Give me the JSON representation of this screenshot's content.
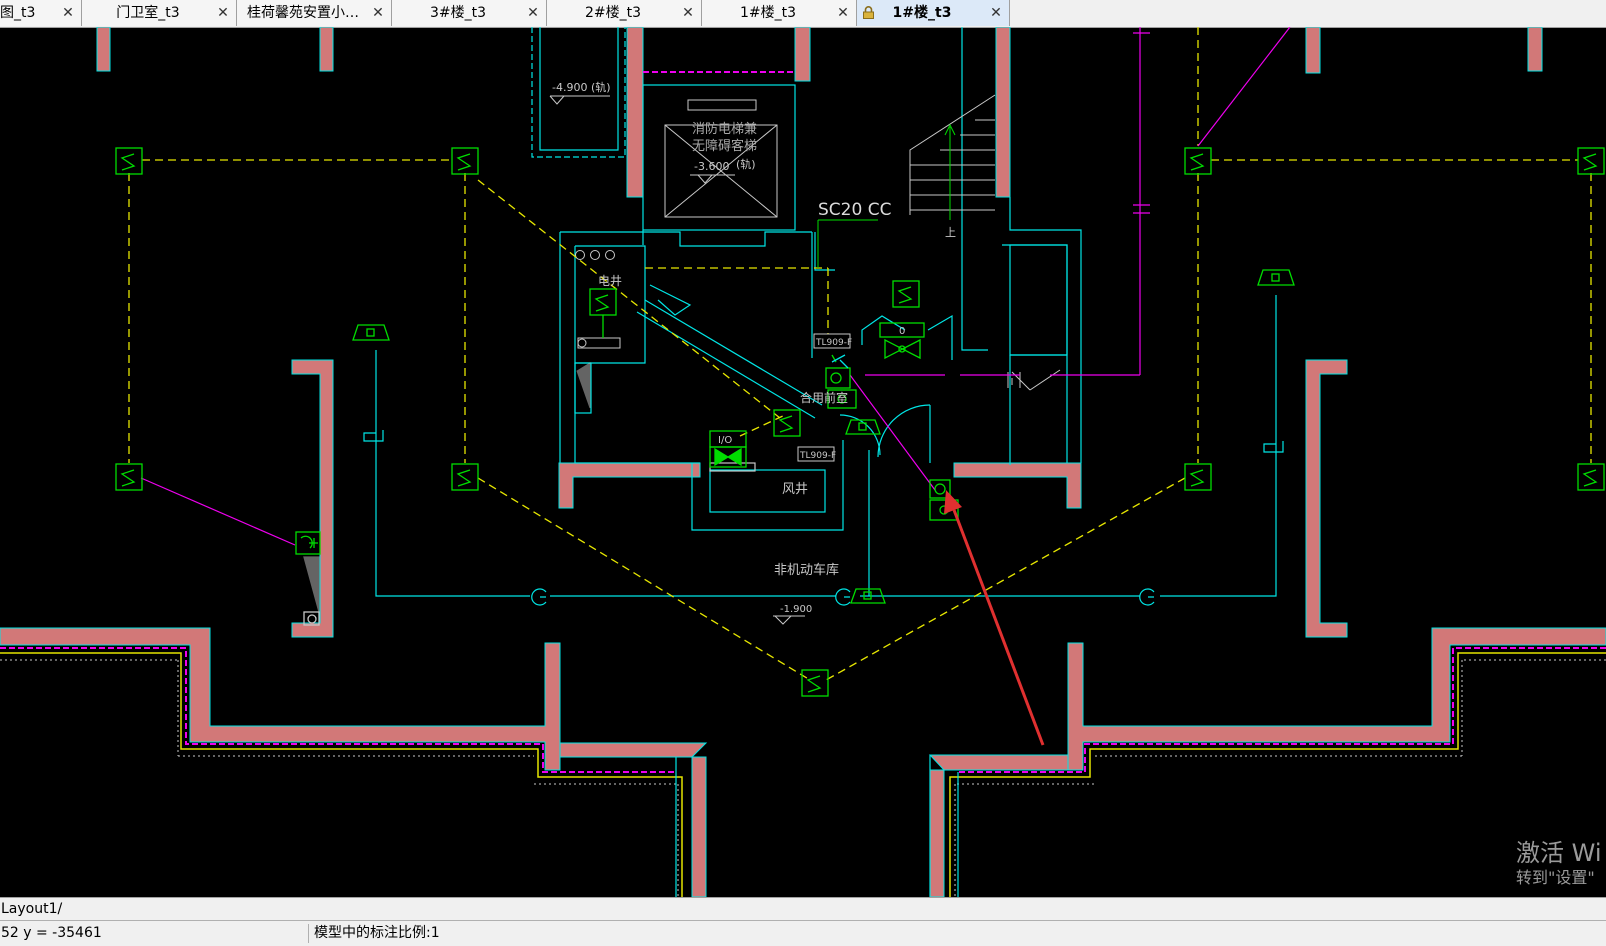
{
  "tabs": [
    {
      "label": "图_t3",
      "close": "✕",
      "active": false,
      "locked": false
    },
    {
      "label": "门卫室_t3",
      "close": "✕",
      "active": false,
      "locked": false
    },
    {
      "label": "桂荷馨苑安置小…",
      "close": "✕",
      "active": false,
      "locked": false
    },
    {
      "label": "3#楼_t3",
      "close": "✕",
      "active": false,
      "locked": false
    },
    {
      "label": "2#楼_t3",
      "close": "✕",
      "active": false,
      "locked": false
    },
    {
      "label": "1#楼_t3",
      "close": "✕",
      "active": false,
      "locked": false
    },
    {
      "label": "1#楼_t3",
      "close": "✕",
      "active": true,
      "locked": true
    }
  ],
  "drawing": {
    "labels": {
      "elev_top": "-4.900",
      "elev_top_note": "(轨)",
      "elevator_1": "消防电梯兼",
      "elevator_2": "无障碍客梯",
      "elev_mid": "-3.600",
      "elev_mid_note": "(轨)",
      "conduit": "SC20 CC",
      "shaft_elec": "电井",
      "tl1": "TL909-F",
      "tl2": "TL909-F",
      "io": "I/O",
      "combined": "合用前室",
      "wind_shaft": "风井",
      "garage": "非机动车库",
      "elev_bottom": "-1.900",
      "up": "上",
      "zero": "0"
    },
    "colors": {
      "wall": "#d27878",
      "cyan": "#00e5e5",
      "yellow": "#e6e600",
      "green": "#00dd00",
      "magenta": "#ee00ee",
      "white": "#c8c8c8",
      "arrow": "#e03030"
    }
  },
  "layout_tab": "Layout1/",
  "status": {
    "coords": "52 y = -35461",
    "scale": "模型中的标注比例:1"
  },
  "watermark": {
    "line1": "激活 Wi",
    "line2": "转到\"设置\""
  }
}
